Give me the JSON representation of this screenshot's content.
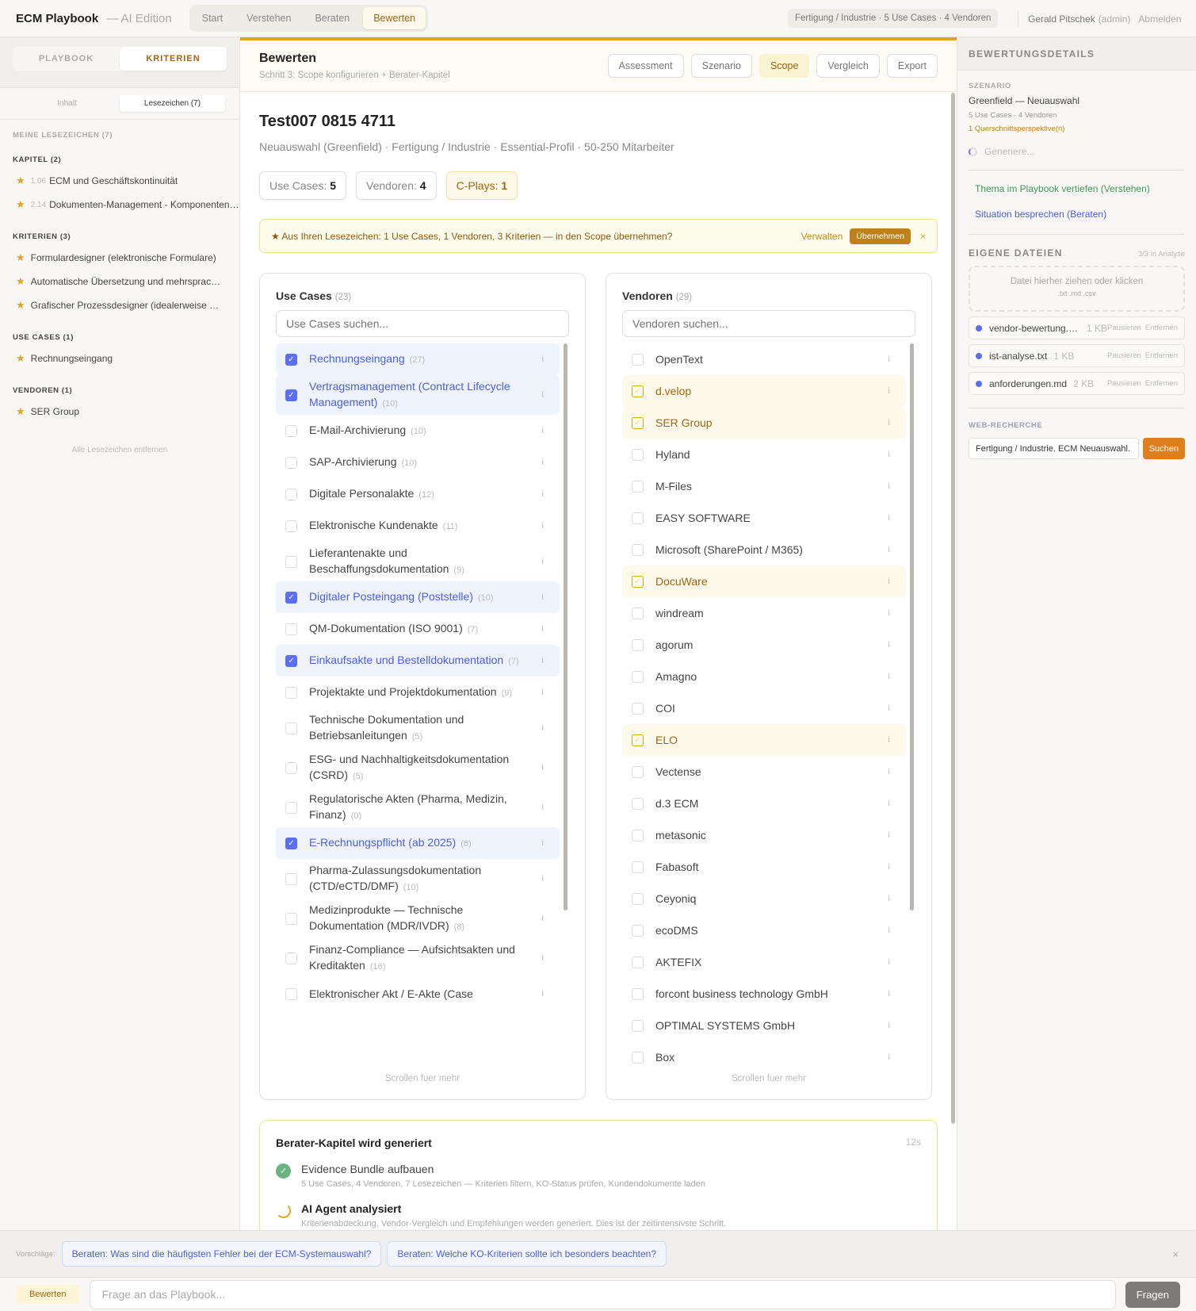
{
  "header": {
    "brand": "ECM Playbook",
    "brand_sub": "— AI Edition",
    "nav": [
      "Start",
      "Verstehen",
      "Beraten",
      "Bewerten"
    ],
    "context": "Fertigung / Industrie · 5 Use Cases · 4 Vendoren",
    "user": "Gerald Pitschek",
    "role": "(admin)",
    "logout": "Abmelden"
  },
  "sidebar": {
    "tabs": [
      "PLAYBOOK",
      "KRITERIEN"
    ],
    "subtabs": [
      "Inhalt",
      "Lesezeichen (7)"
    ],
    "heading": "MEINE LESEZEICHEN (7)",
    "groups": [
      {
        "title": "KAPITEL (2)",
        "items": [
          {
            "num": "1.06",
            "label": "ECM und Geschäftskontinuität"
          },
          {
            "num": "2.14",
            "label": "Dokumenten-Management - Komponenten und Funktionen"
          }
        ]
      },
      {
        "title": "KRITERIEN (3)",
        "items": [
          {
            "label": "Formulardesigner (elektronische Formulare)"
          },
          {
            "label": "Automatische Übersetzung und mehrsprachige Inhalte"
          },
          {
            "label": "Grafischer Prozessdesigner (idealerweise BPMN)"
          }
        ]
      },
      {
        "title": "USE CASES (1)",
        "items": [
          {
            "label": "Rechnungseingang"
          }
        ]
      },
      {
        "title": "VENDOREN (1)",
        "items": [
          {
            "label": "SER Group"
          }
        ]
      }
    ],
    "clear": "Alle Lesezeichen entfernen"
  },
  "main": {
    "title": "Bewerten",
    "subtitle": "Schritt 3: Scope konfigurieren + Berater-Kapitel",
    "steps": [
      "Assessment",
      "Szenario",
      "Scope",
      "Vergleich",
      "Export"
    ],
    "project": "Test007 0815 4711",
    "meta": "Neuauswahl (Greenfield) · Fertigung / Industrie · Essential-Profil · 50-250 Mitarbeiter",
    "chips": [
      {
        "label": "Use Cases: ",
        "value": "5"
      },
      {
        "label": "Vendoren: ",
        "value": "4"
      },
      {
        "label": "C-Plays: ",
        "value": "1"
      }
    ],
    "banner": {
      "text": "★ Aus Ihren Lesezeichen: 1 Use Cases, 1 Vendoren, 3 Kriterien — in den Scope übernehmen?",
      "manage": "Verwalten",
      "accept": "Übernehmen",
      "close": "×"
    },
    "usecases": {
      "title": "Use Cases",
      "count": "(23)",
      "placeholder": "Use Cases suchen...",
      "more": "Scrollen fuer mehr",
      "items": [
        {
          "name": "Rechnungseingang",
          "count": "(27)",
          "checked": true
        },
        {
          "name": "Vertragsmanagement (Contract Lifecycle Management)",
          "count": "(10)",
          "checked": true
        },
        {
          "name": "E-Mail-Archivierung",
          "count": "(10)",
          "checked": false
        },
        {
          "name": "SAP-Archivierung",
          "count": "(10)",
          "checked": false
        },
        {
          "name": "Digitale Personalakte",
          "count": "(12)",
          "checked": false
        },
        {
          "name": "Elektronische Kundenakte",
          "count": "(11)",
          "checked": false
        },
        {
          "name": "Lieferantenakte und Beschaffungsdokumentation",
          "count": "(9)",
          "checked": false
        },
        {
          "name": "Digitaler Posteingang (Poststelle)",
          "count": "(10)",
          "checked": true
        },
        {
          "name": "QM-Dokumentation (ISO 9001)",
          "count": "(7)",
          "checked": false
        },
        {
          "name": "Einkaufsakte und Bestelldokumentation",
          "count": "(7)",
          "checked": true
        },
        {
          "name": "Projektakte und Projektdokumentation",
          "count": "(9)",
          "checked": false
        },
        {
          "name": "Technische Dokumentation und Betriebsanleitungen",
          "count": "(5)",
          "checked": false
        },
        {
          "name": "ESG- und Nachhaltigkeitsdokumentation (CSRD)",
          "count": "(5)",
          "checked": false
        },
        {
          "name": "Regulatorische Akten (Pharma, Medizin, Finanz)",
          "count": "(0)",
          "checked": false
        },
        {
          "name": "E-Rechnungspflicht (ab 2025)",
          "count": "(8)",
          "checked": true
        },
        {
          "name": "Pharma-Zulassungsdokumentation (CTD/eCTD/DMF)",
          "count": "(10)",
          "checked": false
        },
        {
          "name": "Medizinprodukte — Technische Dokumentation (MDR/IVDR)",
          "count": "(8)",
          "checked": false
        },
        {
          "name": "Finanz-Compliance — Aufsichtsakten und Kreditakten",
          "count": "(16)",
          "checked": false
        },
        {
          "name": "Elektronischer Akt / E-Akte (Case",
          "count": "",
          "checked": false
        }
      ]
    },
    "vendors": {
      "title": "Vendoren",
      "count": "(29)",
      "placeholder": "Vendoren suchen...",
      "more": "Scrollen fuer mehr",
      "items": [
        {
          "name": "OpenText",
          "checked": false
        },
        {
          "name": "d.velop",
          "checked": true
        },
        {
          "name": "SER Group",
          "checked": true
        },
        {
          "name": "Hyland",
          "checked": false
        },
        {
          "name": "M-Files",
          "checked": false
        },
        {
          "name": "EASY SOFTWARE",
          "checked": false
        },
        {
          "name": "Microsoft (SharePoint / M365)",
          "checked": false
        },
        {
          "name": "DocuWare",
          "checked": true
        },
        {
          "name": "windream",
          "checked": false
        },
        {
          "name": "agorum",
          "checked": false
        },
        {
          "name": "Amagno",
          "checked": false
        },
        {
          "name": "COI",
          "checked": false
        },
        {
          "name": "ELO",
          "checked": true
        },
        {
          "name": "Vectense",
          "checked": false
        },
        {
          "name": "d.3 ECM",
          "checked": false
        },
        {
          "name": "metasonic",
          "checked": false
        },
        {
          "name": "Fabasoft",
          "checked": false
        },
        {
          "name": "Ceyoniq",
          "checked": false
        },
        {
          "name": "ecoDMS",
          "checked": false
        },
        {
          "name": "AKTEFIX",
          "checked": false
        },
        {
          "name": "forcont business technology GmbH",
          "checked": false
        },
        {
          "name": "OPTIMAL SYSTEMS GmbH",
          "checked": false
        },
        {
          "name": "Box",
          "checked": false
        }
      ]
    },
    "generation": {
      "title": "Berater-Kapitel wird generiert",
      "elapsed": "12s",
      "steps": [
        {
          "title": "Evidence Bundle aufbauen",
          "desc": "5 Use Cases, 4 Vendoren, 7 Lesezeichen — Kriterien filtern, KO-Status prüfen, Kundendokumente laden",
          "status": "done"
        },
        {
          "title": "AI Agent analysiert",
          "desc": "Kriterienabdeckung, Vendor-Vergleich und Empfehlungen werden generiert. Dies ist der zeitintensivste Schritt.",
          "status": "running"
        }
      ]
    }
  },
  "right": {
    "title": "BEWERTUNGSDETAILS",
    "scenario_label": "SZENARIO",
    "scenario": "Greenfield — Neuauswahl",
    "scenario_meta": "5 Use Cases · 4 Vendoren",
    "perspectives": "1 Querschnittsperspektive(n)",
    "generating": "Generiere...",
    "link_understand": "Thema im Playbook vertiefen (Verstehen)",
    "link_advise": "Situation besprechen (Beraten)",
    "files_title": "EIGENE DATEIEN",
    "files_status": "3/3 in Analyse",
    "drop": "Datei hierher ziehen oder klicken",
    "drop_types": ".txt .md .csv",
    "files": [
      {
        "name": "vendor-bewertung.csv",
        "size": "1 KB"
      },
      {
        "name": "ist-analyse.txt",
        "size": "1 KB"
      },
      {
        "name": "anforderungen.md",
        "size": "2 KB"
      }
    ],
    "pause": "Pausieren",
    "remove": "Entfernen",
    "web_title": "WEB-RECHERCHE",
    "web_query": "Fertigung / Industrie. ECM Neuauswahl. Relevante Anbieter",
    "web_button": "Suchen"
  },
  "bottom": {
    "label": "Vorschläge:",
    "suggestions": [
      "Beraten: Was sind die häufigsten Fehler bei der ECM-Systemauswahl?",
      "Beraten: Welche KO-Kriterien sollte ich besonders beachten?"
    ],
    "close": "×",
    "mode": "Bewerten",
    "placeholder": "Frage an das Playbook...",
    "ask": "Fragen"
  },
  "colors": {
    "accent": "#e0a526",
    "selected": "#5b6ff0",
    "search_button": "#de7f1d"
  }
}
